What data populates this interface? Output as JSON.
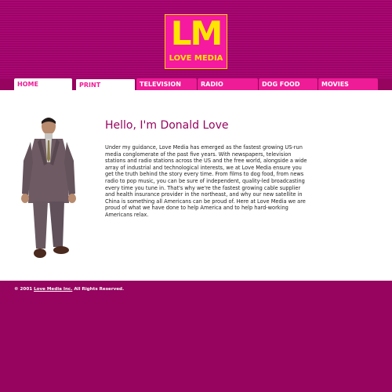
{
  "logo": {
    "big": "LM",
    "small": "LOVE MEDIA"
  },
  "nav": {
    "tabs": [
      {
        "label": "HOME"
      },
      {
        "label": "PRINT"
      },
      {
        "label": "TELEVISION"
      },
      {
        "label": "RADIO"
      },
      {
        "label": "DOG FOOD"
      },
      {
        "label": "MOVIES"
      }
    ]
  },
  "main": {
    "title": "Hello, I'm Donald Love",
    "body": "Under my guidance, Love Media has emerged as the fastest growing US-run media conglomerate of the past five years. With newspapers, television stations and radio stations across the US and the free world, alongside a wide array of industrial and technological interests, we at Love Media ensure you get the truth behind the story every time. From films to dog food, from news radio to pop music, you can be sure of independent, quality-led broadcasting every time you tune in. That's why we're the fastest growing cable supplier and health insurance provider in the northeast, and why our new satellite in China is something all Americans can be proud of. Here at Love Media we are proud of what we have done to help America and to help hard-working Americans relax."
  },
  "footer": {
    "prefix": "© 2001 ",
    "link": "Love Media Inc.",
    "suffix": " All Rights Reserved."
  },
  "colors": {
    "background": "#96045f",
    "accent": "#ee1c96",
    "logo_text": "#ffe600",
    "title": "#96045f"
  }
}
